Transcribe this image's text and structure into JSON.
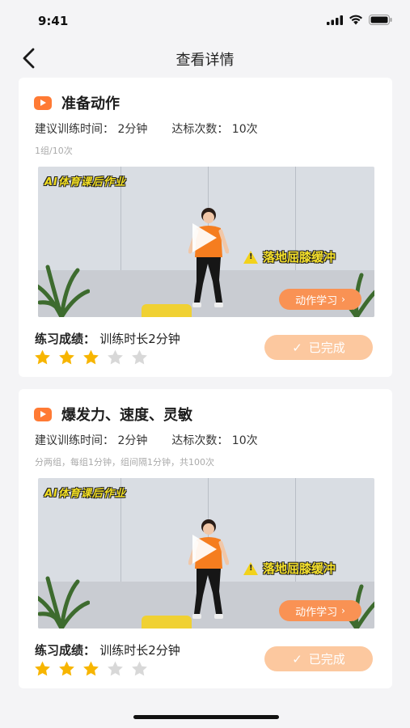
{
  "status": {
    "time": "9:41"
  },
  "nav": {
    "title": "查看详情"
  },
  "cards": [
    {
      "title": "准备动作",
      "suggest_time": "建议训练时间：  2分钟",
      "target_count": "达标次数：  10次",
      "note": "1组/10次",
      "video_banner": "AI体育课后作业",
      "video_caption": "落地屈膝缓冲",
      "learn_label": "动作学习",
      "score_label": "练习成绩：",
      "score_value": "训练时长2分钟",
      "rating": 3,
      "rating_max": 5,
      "done_label": "已完成"
    },
    {
      "title": "爆发力、速度、灵敏",
      "suggest_time": "建议训练时间：  2分钟",
      "target_count": "达标次数：  10次",
      "note": "分两组，每组1分钟，组间隔1分钟，共100次",
      "video_banner": "AI体育课后作业",
      "video_caption": "落地屈膝缓冲",
      "learn_label": "动作学习",
      "score_label": "练习成绩：",
      "score_value": "训练时长2分钟",
      "rating": 3,
      "rating_max": 5,
      "done_label": "已完成"
    }
  ],
  "colors": {
    "accent": "#ff7a34",
    "star_on": "#f7b500",
    "star_off": "#d8d8d8",
    "done_button": "#fcc89f"
  }
}
